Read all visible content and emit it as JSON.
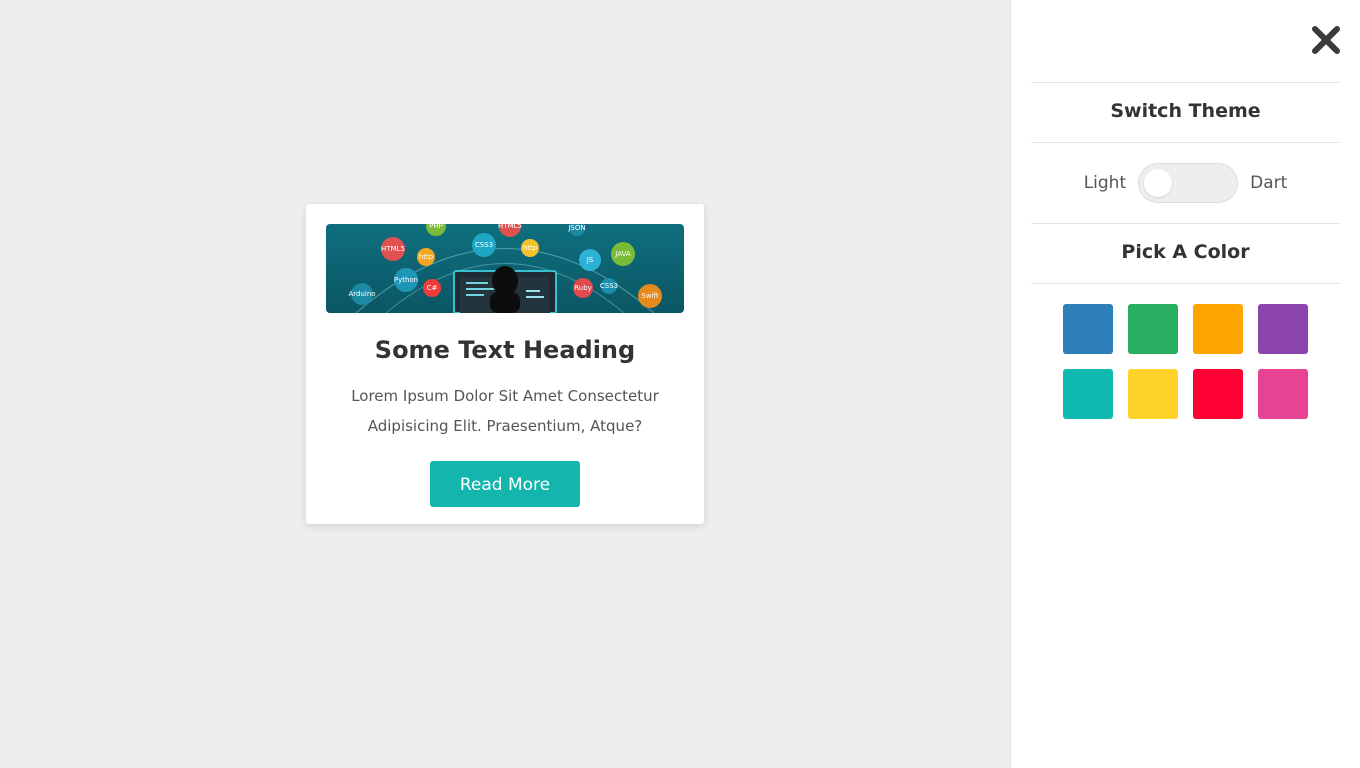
{
  "card": {
    "title": "Some Text Heading",
    "description": "Lorem Ipsum Dolor Sit Amet Consectetur Adipisicing Elit. Praesentium, Atque?",
    "button_label": "Read More",
    "accent_color": "#13b5ad",
    "image": {
      "badges": [
        "HTML5",
        "http",
        "CSS3",
        "http",
        "JS",
        "JAVA",
        "Python",
        "C#",
        "Ruby",
        "CSS3",
        "Swift",
        "Arduino",
        "HTML5",
        "PHP",
        "JSON"
      ]
    }
  },
  "panel": {
    "switch_theme_title": "Switch Theme",
    "light_label": "Light",
    "dark_label": "Dart",
    "pick_color_title": "Pick A Color",
    "close_icon": "close-icon",
    "colors": [
      "#2c7fb8",
      "#27ae60",
      "#ffa500",
      "#8e44ad",
      "#10b9b0",
      "#ffd32a",
      "#ff0033",
      "#e84393"
    ]
  }
}
